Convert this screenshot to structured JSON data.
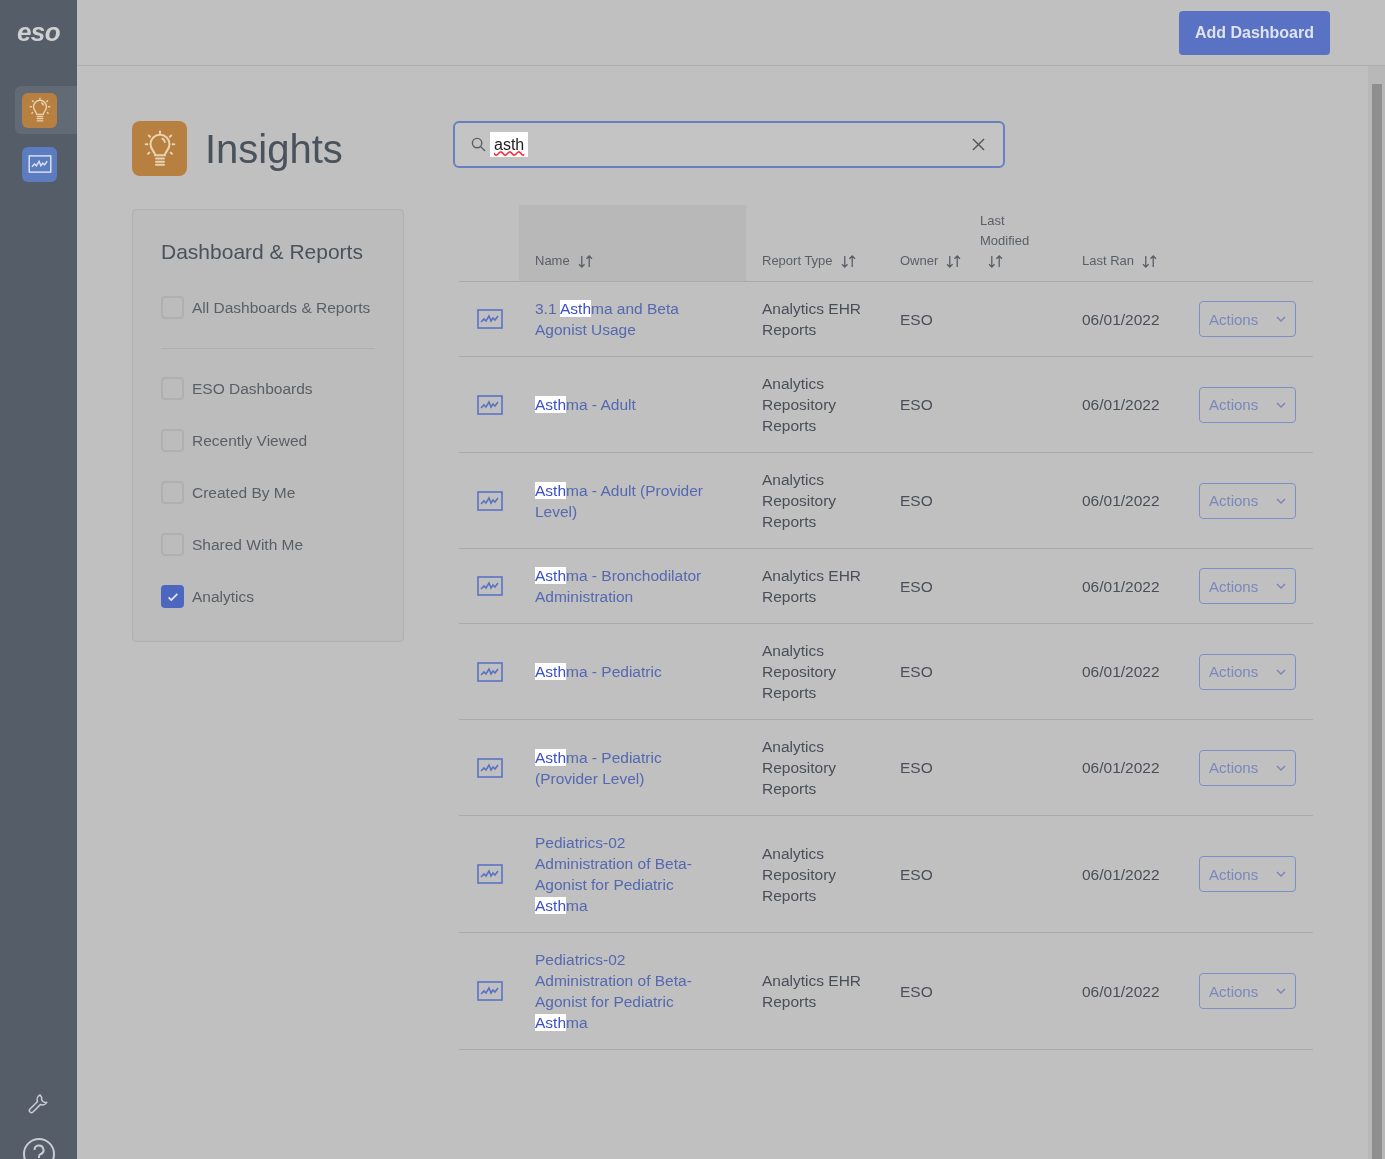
{
  "sidebar": {
    "logo": "eso",
    "apps": [
      {
        "kind": "insights",
        "selected": true
      },
      {
        "kind": "analytics",
        "selected": false
      }
    ]
  },
  "header": {
    "add_button": "Add Dashboard"
  },
  "page": {
    "title": "Insights"
  },
  "search": {
    "value": "asth"
  },
  "filters": {
    "title": "Dashboard & Reports",
    "items": [
      {
        "label": "All Dashboards & Reports",
        "checked": false,
        "divider_after": true
      },
      {
        "label": "ESO Dashboards",
        "checked": false
      },
      {
        "label": "Recently Viewed",
        "checked": false
      },
      {
        "label": "Created By Me",
        "checked": false
      },
      {
        "label": "Shared With Me",
        "checked": false
      },
      {
        "label": "Analytics",
        "checked": true
      }
    ]
  },
  "table": {
    "columns": [
      {
        "label": "Name",
        "sortable": true
      },
      {
        "label": "Report Type",
        "sortable": true
      },
      {
        "label": "Owner",
        "sortable": true
      },
      {
        "label": "Last Modified",
        "sortable": true
      },
      {
        "label": "Last Ran",
        "sortable": true
      }
    ],
    "rows": [
      {
        "name": [
          {
            "text": "3.1 ",
            "highlighted": false
          },
          {
            "text": "Asth",
            "highlighted": true
          },
          {
            "text": "ma and Beta Agonist Usage",
            "highlighted": false
          }
        ],
        "report_type": "Analytics EHR Reports",
        "owner": "ESO",
        "last_ran": "06/01/2022",
        "action": "Actions"
      },
      {
        "name": [
          {
            "text": "Asth",
            "highlighted": true
          },
          {
            "text": "ma - Adult",
            "highlighted": false
          }
        ],
        "report_type": "Analytics Repository Reports",
        "owner": "ESO",
        "last_ran": "06/01/2022",
        "action": "Actions"
      },
      {
        "name": [
          {
            "text": "Asth",
            "highlighted": true
          },
          {
            "text": "ma - Adult (Provider Level)",
            "highlighted": false
          }
        ],
        "report_type": "Analytics Repository Reports",
        "owner": "ESO",
        "last_ran": "06/01/2022",
        "action": "Actions"
      },
      {
        "name": [
          {
            "text": "Asth",
            "highlighted": true
          },
          {
            "text": "ma - Bronchodilator Administration",
            "highlighted": false
          }
        ],
        "report_type": "Analytics EHR Reports",
        "owner": "ESO",
        "last_ran": "06/01/2022",
        "action": "Actions"
      },
      {
        "name": [
          {
            "text": "Asth",
            "highlighted": true
          },
          {
            "text": "ma - Pediatric",
            "highlighted": false
          }
        ],
        "report_type": "Analytics Repository Reports",
        "owner": "ESO",
        "last_ran": "06/01/2022",
        "action": "Actions"
      },
      {
        "name": [
          {
            "text": "Asth",
            "highlighted": true
          },
          {
            "text": "ma - Pediatric (Provider Level)",
            "highlighted": false
          }
        ],
        "report_type": "Analytics Repository Reports",
        "owner": "ESO",
        "last_ran": "06/01/2022",
        "action": "Actions"
      },
      {
        "name": [
          {
            "text": "Pediatrics-02 Administration of Beta-Agonist for Pediatric ",
            "highlighted": false
          },
          {
            "text": "Asth",
            "highlighted": true
          },
          {
            "text": "ma",
            "highlighted": false
          }
        ],
        "report_type": "Analytics Repository Reports",
        "owner": "ESO",
        "last_ran": "06/01/2022",
        "action": "Actions"
      },
      {
        "name": [
          {
            "text": "Pediatrics-02 Administration of Beta-Agonist for Pediatric ",
            "highlighted": false
          },
          {
            "text": "Asth",
            "highlighted": true
          },
          {
            "text": "ma",
            "highlighted": false
          }
        ],
        "report_type": "Analytics EHR Reports",
        "owner": "ESO",
        "last_ran": "06/01/2022",
        "action": "Actions"
      }
    ]
  }
}
